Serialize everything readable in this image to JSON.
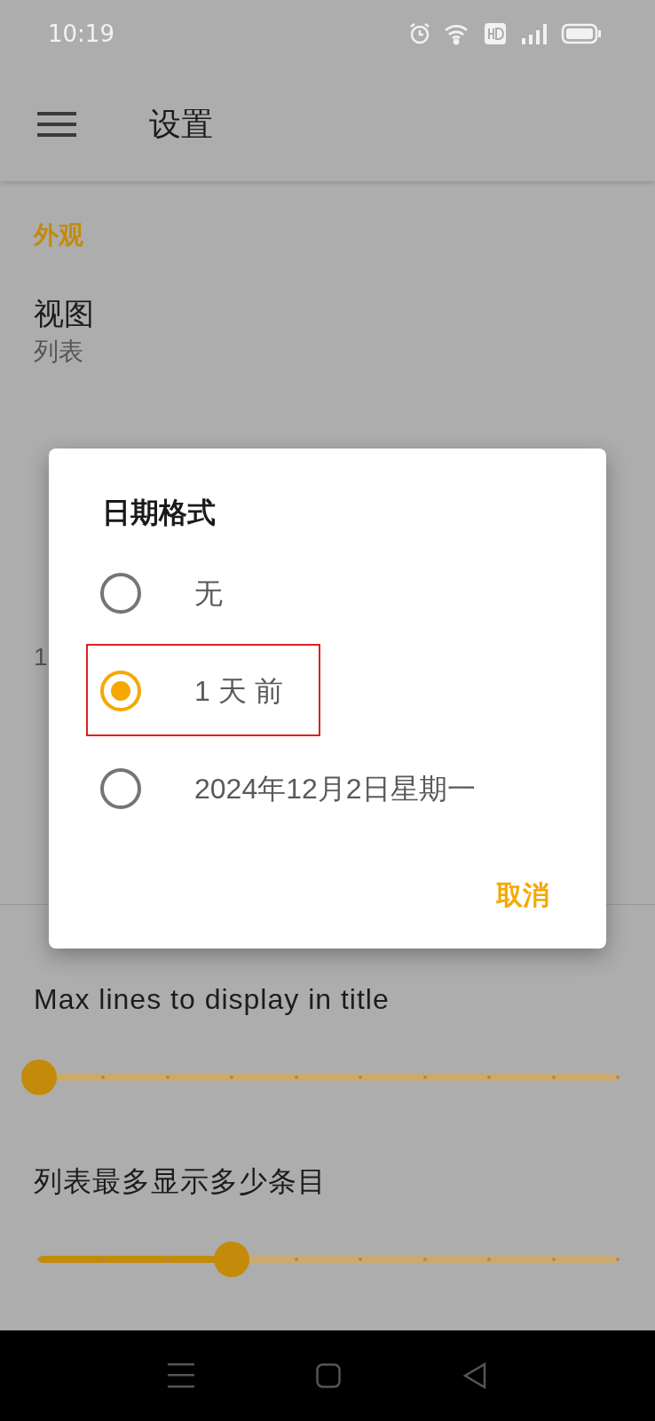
{
  "status_bar": {
    "time": "10:19"
  },
  "toolbar": {
    "title": "设置"
  },
  "sections": [
    {
      "header": "外观",
      "items": [
        {
          "kind": "pref",
          "title": "视图",
          "summary": "列表"
        },
        {
          "kind": "pref"
        },
        {
          "kind": "pref",
          "summary": "1"
        },
        {
          "kind": "pref"
        }
      ]
    },
    {
      "items": [
        {
          "kind": "slider",
          "title": "Max lines to display in title",
          "level": 0
        },
        {
          "kind": "slider",
          "title": "列表最多显示多少条目",
          "level": 0.333
        }
      ]
    }
  ],
  "dialog": {
    "title": "日期格式",
    "options": [
      {
        "label": "无",
        "selected": false,
        "highlighted": false
      },
      {
        "label": "1 天 前",
        "selected": true,
        "highlighted": true
      },
      {
        "label": "2024年12月2日星期一",
        "selected": false,
        "highlighted": false
      }
    ],
    "buttons": [
      "取消"
    ]
  }
}
